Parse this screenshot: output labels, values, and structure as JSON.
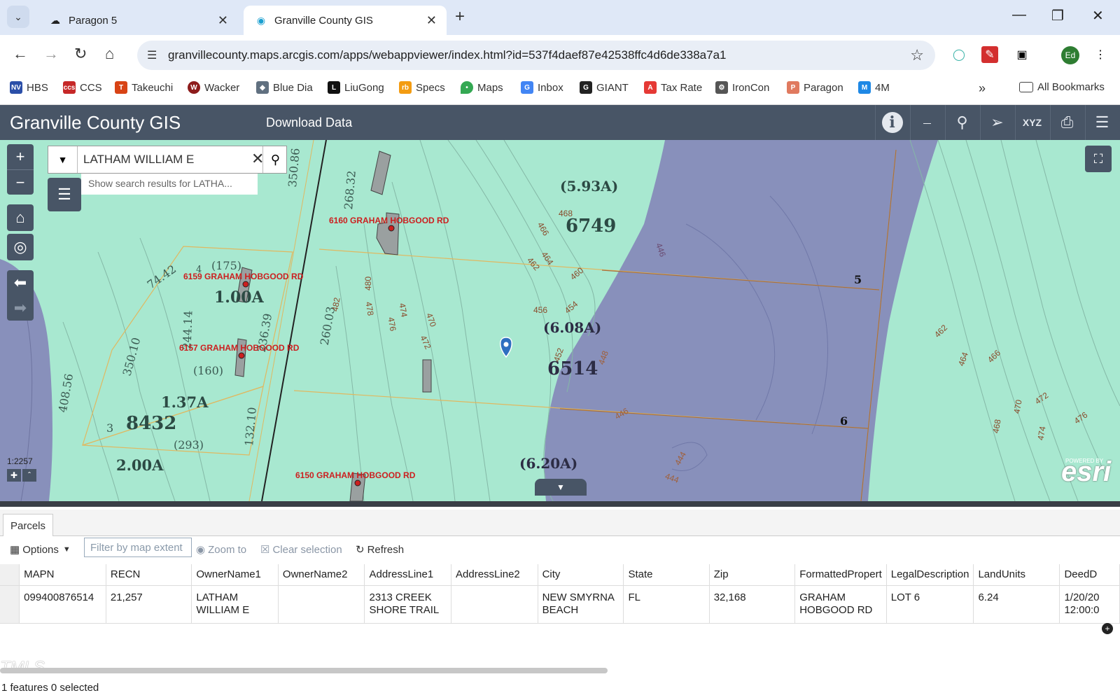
{
  "browser": {
    "tabs": [
      {
        "title": "Paragon 5",
        "icon": "paragon-icon"
      },
      {
        "title": "Granville County GIS",
        "icon": "arcgis-icon"
      }
    ],
    "url": "granvillecounty.maps.arcgis.com/apps/webappviewer/index.html?id=537f4daef87e42538ffc4d6de338a7a1",
    "profile_initials": "Ed",
    "bookmarks": [
      "HBS",
      "CCS",
      "Takeuchi",
      "Wacker",
      "Blue Dia",
      "LiuGong",
      "Specs",
      "Maps",
      "Inbox",
      "GIANT",
      "Tax Rate",
      "IronCon",
      "Paragon",
      "4M"
    ],
    "all_bookmarks_label": "All Bookmarks"
  },
  "app": {
    "title": "Granville County GIS",
    "download_label": "Download Data",
    "widgets": [
      "info-icon",
      "measure-icon",
      "zoom-search-icon",
      "select-icon",
      "xyz-icon",
      "print-icon",
      "layers-icon"
    ],
    "xyz_label": "XYZ"
  },
  "map": {
    "search_value": "LATHAM WILLIAM E",
    "search_suggestion": "Show search results for LATHA...",
    "scale": "1:2257",
    "attribution": "esri",
    "attribution_small": "POWERED BY",
    "parcel_numbers": [
      "6749",
      "6514",
      "8432"
    ],
    "acreage_labels": [
      "(5.93A)",
      "(6.08A)",
      "(6.20A)",
      "1.00A",
      "1.37A",
      "2.00A"
    ],
    "dimension_labels": [
      "74.42",
      "(175)",
      "244.14",
      "236.39",
      "350.10",
      "408.56",
      "260.03",
      "268.32",
      "350.86",
      "132.10",
      "(160)",
      "(293)"
    ],
    "lot_numbers": [
      "5",
      "6",
      "3",
      "4"
    ],
    "address_labels": [
      "6160 GRAHAM HOBGOOD RD",
      "6159 GRAHAM HOBGOOD RD",
      "6157 GRAHAM HOBGOOD RD",
      "6150 GRAHAM HOBGOOD RD"
    ],
    "contour_labels": [
      "468",
      "466",
      "464",
      "462",
      "460",
      "456",
      "454",
      "452",
      "448",
      "446",
      "480",
      "482",
      "478",
      "476",
      "474",
      "472",
      "470",
      "444",
      "462",
      "464",
      "466",
      "468",
      "470",
      "472",
      "474",
      "476",
      "446",
      "444"
    ],
    "colors": {
      "land": "#a8e8d0",
      "water": "#8890bb",
      "parcel_line": "#e0b860",
      "label_red": "#cc1f1f"
    }
  },
  "attribute_table": {
    "tab": "Parcels",
    "toolbar": {
      "options": "Options",
      "filter": "Filter by map extent",
      "zoom": "Zoom to",
      "clear": "Clear selection",
      "refresh": "Refresh"
    },
    "columns": [
      "MAPN",
      "RECN",
      "OwnerName1",
      "OwnerName2",
      "AddressLine1",
      "AddressLine2",
      "City",
      "State",
      "Zip",
      "FormattedPropert",
      "LegalDescription",
      "LandUnits",
      "DeedD"
    ],
    "rows": [
      [
        "099400876514",
        "21,257",
        "LATHAM WILLIAM E",
        "",
        "2313 CREEK SHORE TRAIL",
        "",
        "NEW SMYRNA BEACH",
        "FL",
        "32,168",
        "GRAHAM HOBGOOD RD",
        "LOT 6",
        "6.24",
        "1/20/20 12:00:0"
      ]
    ],
    "status": "1 features 0 selected"
  },
  "watermark": "TMLS"
}
